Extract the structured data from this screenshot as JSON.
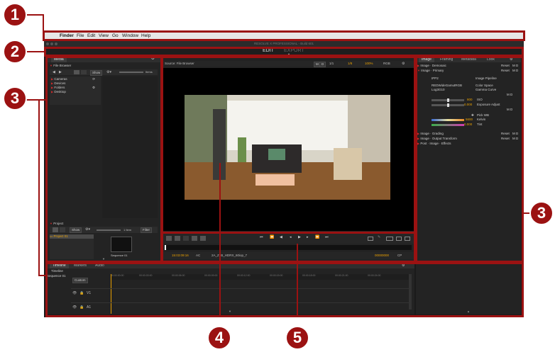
{
  "menubar": {
    "apple_glyph": "",
    "items": [
      "Finder",
      "File",
      "Edit",
      "View",
      "Go",
      "Window",
      "Help"
    ]
  },
  "app": {
    "title": "RESOLVE X PROFESSIONAL - Build 601",
    "pages": {
      "edit": "EDIT",
      "export": "EXPORT"
    }
  },
  "media_panel": {
    "tab": "Media",
    "file_browser": {
      "label": "File Browser",
      "show_label": "Show",
      "items_count": "Items",
      "tree": [
        "Cameras",
        "Devices",
        "Folders",
        "Desktop"
      ]
    },
    "project": {
      "label": "Project",
      "show_label": "Show",
      "items_count": "1 Item",
      "filter_label": "Filter",
      "folder": "Project 01",
      "sequence": "Sequence 01"
    }
  },
  "viewer": {
    "source_label": "Source: File Browser",
    "mode_buttons": [
      "M",
      "D"
    ],
    "controls": [
      "1/1",
      "1/8",
      "100%",
      "RGB"
    ],
    "timecode_left": "15:03:09:16",
    "audio_label": "AC",
    "clip_name": "2A_Z6B_HDRX_60iop_7",
    "timecode_right": "00000000",
    "cp_label": "CP"
  },
  "inspector": {
    "tabs": [
      "Image",
      "Framing",
      "Metadata",
      "Look"
    ],
    "sections": {
      "demosaic": "Image · Demosaic",
      "primary": "Image · Primary",
      "grading": "Image · Grading",
      "output": "Image · Output Transform",
      "post": "Post · Image · Effects"
    },
    "reset": "Reset",
    "md": "M D",
    "primary": {
      "ipp2": "IPP2",
      "pipeline": "Image Pipeline",
      "colorspace_value": "REDWideGamutRGB",
      "gamma_value": "Log3G10",
      "colorspace": "Color Space",
      "gamma": "Gamma Curve",
      "iso_value": "800",
      "iso": "ISO",
      "exposure_value": "0.000",
      "exposure": "Exposure Adjust",
      "pickwb": "Pick WB",
      "kelvin_value": "5600",
      "kelvin": "Kelvin",
      "tint_value": "0.000",
      "tint": "Tint"
    }
  },
  "timeline": {
    "tabs": [
      "Timeline",
      "Markers",
      "Audio"
    ],
    "label": "Timeline",
    "sequence": "Sequence 01",
    "zoom_label": "Custom",
    "tracks": [
      "V1",
      "A1"
    ],
    "ticks": [
      "00:00:00:00",
      "00:00:03:00",
      "00:00:06:00",
      "00:00:09:00",
      "00:00:12:00",
      "00:00:15:00",
      "00:00:18:00",
      "00:00:21:00",
      "00:00:24:00"
    ]
  },
  "callouts": [
    "1",
    "2",
    "3",
    "3",
    "4",
    "5"
  ],
  "colors": {
    "callout": "#9b1212",
    "accent": "#e8a000"
  }
}
